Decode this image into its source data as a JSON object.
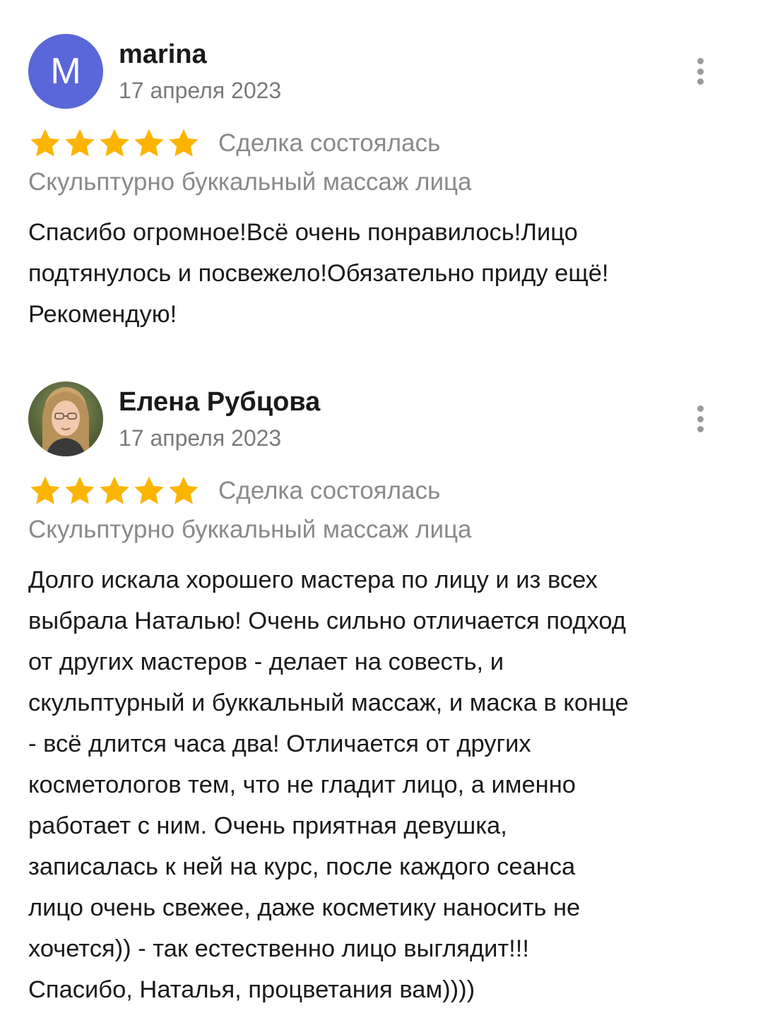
{
  "colors": {
    "star": "#fbb500",
    "avatar_letter_bg": "#5a67d8",
    "secondary_text": "#8a8a8a",
    "primary_text": "#1a1a1a"
  },
  "reviews": [
    {
      "author": "marina",
      "avatar_letter": "M",
      "date": "17 апреля 2023",
      "rating": 5,
      "deal_status": "Сделка состоялась",
      "service": "Скульптурно буккальный массаж лица",
      "text_lines": [
        "Спасибо огромное!Всё очень понравилось!Лицо",
        "подтянулось и посвежело!Обязательно приду ещё!",
        "Рекомендую!"
      ],
      "more_icon": "more-vertical-icon"
    },
    {
      "author": "Елена Рубцова",
      "avatar_letter": "",
      "date": "17 апреля 2023",
      "rating": 5,
      "deal_status": "Сделка состоялась",
      "service": "Скульптурно буккальный массаж лица",
      "text_lines": [
        "Долго искала хорошего мастера по лицу и из всех",
        "выбрала Наталью! Очень сильно отличается подход",
        "от других мастеров - делает на совесть, и",
        "скульптурный и буккальный массаж, и маска в конце",
        "- всё длится часа два! Отличается от других",
        "косметологов тем, что не гладит лицо, а именно",
        "работает с ним. Очень приятная девушка,",
        "записалась к ней на курс, после каждого сеанса",
        "лицо очень свежее, даже косметику наносить не",
        "хочется)) - так естественно лицо выглядит!!!",
        "Спасибо, Наталья, процветания вам))))"
      ],
      "more_icon": "more-vertical-icon"
    }
  ]
}
